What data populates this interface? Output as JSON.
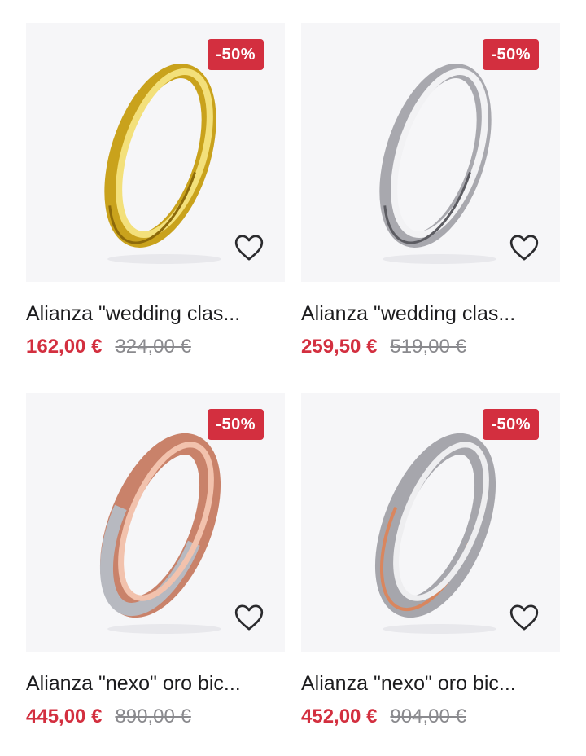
{
  "products": [
    {
      "badge": "-50%",
      "title": "Alianza \"wedding clas...",
      "price": "162,00 €",
      "old_price": "324,00 €",
      "ring_colors": [
        "#f3e07a",
        "#c9a21c",
        "#8d6a0a",
        "#fff4b8"
      ],
      "image": "gold-ring-image",
      "favorite_icon": "heart-outline-icon"
    },
    {
      "badge": "-50%",
      "title": "Alianza \"wedding clas...",
      "price": "259,50 €",
      "old_price": "519,00 €",
      "ring_colors": [
        "#f2f2f4",
        "#a8a8ae",
        "#5c5c62",
        "#ffffff"
      ],
      "image": "white-gold-ring-image",
      "favorite_icon": "heart-outline-icon"
    },
    {
      "badge": "-50%",
      "title": "Alianza \"nexo\" oro bic...",
      "price": "445,00 €",
      "old_price": "890,00 €",
      "ring_colors": [
        "#f2c2ad",
        "#c9826a",
        "#8a4a38",
        "#b7b9c0"
      ],
      "image": "rose-white-gold-ring-image",
      "favorite_icon": "heart-outline-icon"
    },
    {
      "badge": "-50%",
      "title": "Alianza \"nexo\" oro bic...",
      "price": "452,00 €",
      "old_price": "904,00 €",
      "ring_colors": [
        "#eeeef0",
        "#a6a6ac",
        "#5a5a60",
        "#d9865e"
      ],
      "image": "bicolor-gold-ring-image",
      "favorite_icon": "heart-outline-icon"
    }
  ],
  "colors": {
    "accent": "#d32f3f",
    "card_bg": "#f6f6f8",
    "text": "#1c1c1e",
    "muted": "#8a8a8e"
  }
}
